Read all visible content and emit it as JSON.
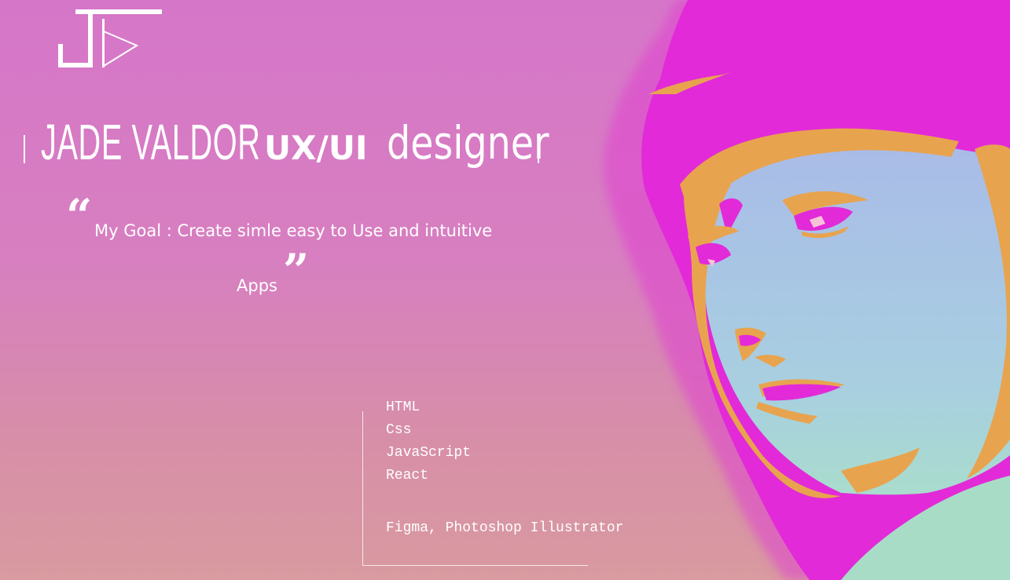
{
  "logo": {
    "letters": "JV"
  },
  "header": {
    "name": "JADE VALDOR",
    "role_strong": "UX/UI",
    "role_light": "designer"
  },
  "quote": {
    "open_mark": "“",
    "line1": "My Goal : Create simle easy to Use and intuitive",
    "line2": "Apps",
    "close_mark": "”"
  },
  "skills": {
    "items": [
      "HTML",
      "Css",
      "JavaScript",
      "React"
    ],
    "tools": "Figma, Photoshop Illustrator"
  },
  "portrait": {
    "description_icon": "portrait-illustration"
  },
  "colors": {
    "background": "#d676c9",
    "magenta": "#e22ad8",
    "orange": "#e8a34f",
    "skin_blue": "#a9bfe6",
    "mint": "#a7dcc9"
  }
}
